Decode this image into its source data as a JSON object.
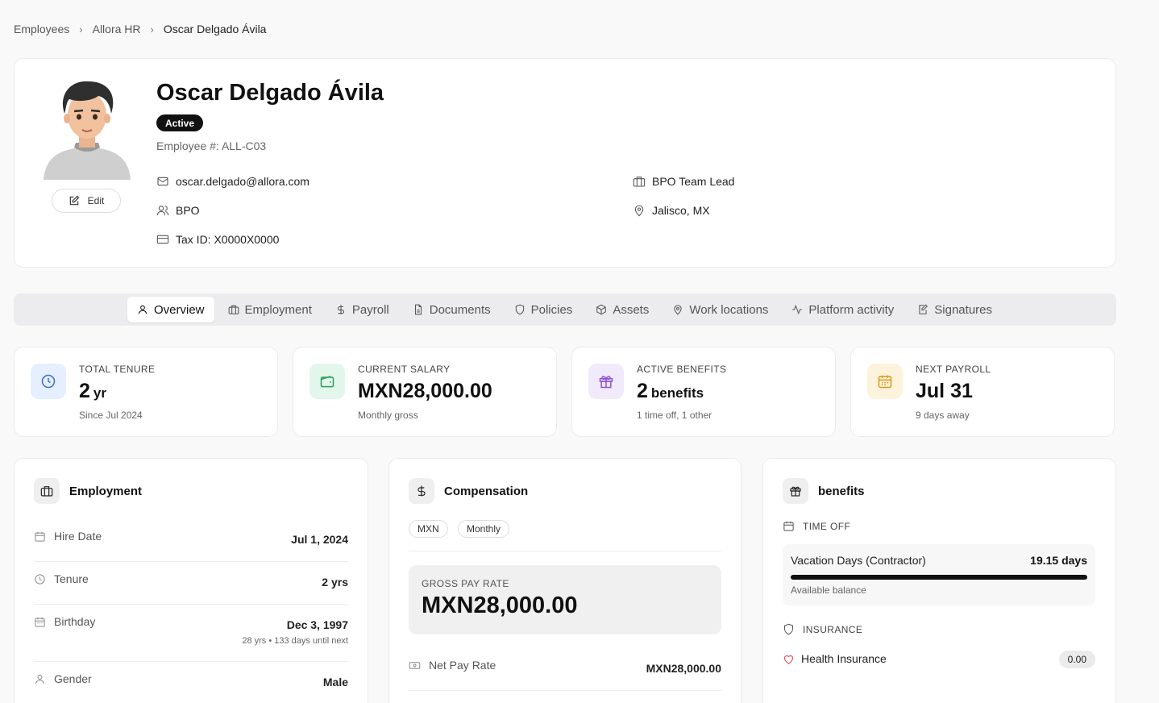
{
  "breadcrumb": {
    "items": [
      "Employees",
      "Allora HR",
      "Oscar Delgado Ávila"
    ]
  },
  "profile": {
    "name": "Oscar Delgado Ávila",
    "status": "Active",
    "employee_number": "Employee #: ALL-C03",
    "edit_label": "Edit",
    "email": "oscar.delgado@allora.com",
    "department": "BPO",
    "tax_id": "Tax ID: X0000X0000",
    "job_title": "BPO Team Lead",
    "location": "Jalisco, MX"
  },
  "tabs": [
    {
      "label": "Overview",
      "icon": "user-icon",
      "active": true
    },
    {
      "label": "Employment",
      "icon": "briefcase-icon"
    },
    {
      "label": "Payroll",
      "icon": "dollar-icon"
    },
    {
      "label": "Documents",
      "icon": "document-icon"
    },
    {
      "label": "Policies",
      "icon": "shield-icon"
    },
    {
      "label": "Assets",
      "icon": "box-icon"
    },
    {
      "label": "Work locations",
      "icon": "map-pin-icon"
    },
    {
      "label": "Platform activity",
      "icon": "activity-icon"
    },
    {
      "label": "Signatures",
      "icon": "signature-icon"
    }
  ],
  "stats": {
    "tenure": {
      "label": "TOTAL TENURE",
      "value": "2",
      "unit": "yr",
      "sub": "Since Jul 2024",
      "color": "#e6efff"
    },
    "salary": {
      "label": "CURRENT SALARY",
      "value": "MXN28,000.00",
      "sub": "Monthly gross",
      "color": "#e3f6ec"
    },
    "benefits": {
      "label": "ACTIVE BENEFITS",
      "value": "2",
      "unit": "benefits",
      "sub": "1 time off, 1 other",
      "color": "#f0eafb"
    },
    "payroll": {
      "label": "NEXT PAYROLL",
      "value": "Jul 31",
      "sub": "9 days away",
      "color": "#fdf3dc"
    }
  },
  "employment": {
    "title": "Employment",
    "hire_date_label": "Hire Date",
    "hire_date": "Jul 1, 2024",
    "tenure_label": "Tenure",
    "tenure": "2 yrs",
    "birthday_label": "Birthday",
    "birthday": "Dec 3, 1997",
    "birthday_sub": "28 yrs • 133 days until next",
    "gender_label": "Gender",
    "gender": "Male"
  },
  "compensation": {
    "title": "Compensation",
    "currency": "MXN",
    "frequency": "Monthly",
    "gross_label": "GROSS PAY RATE",
    "gross": "MXN28,000.00",
    "net_label": "Net Pay Rate",
    "net": "MXN28,000.00"
  },
  "benefits": {
    "title": "benefits",
    "time_off_label": "TIME OFF",
    "vacation_name": "Vacation Days (Contractor)",
    "vacation_days": "19.15 days",
    "vacation_fill": 1.0,
    "vacation_sub": "Available balance",
    "insurance_label": "INSURANCE",
    "insurance_name": "Health Insurance",
    "insurance_value": "0.00"
  }
}
